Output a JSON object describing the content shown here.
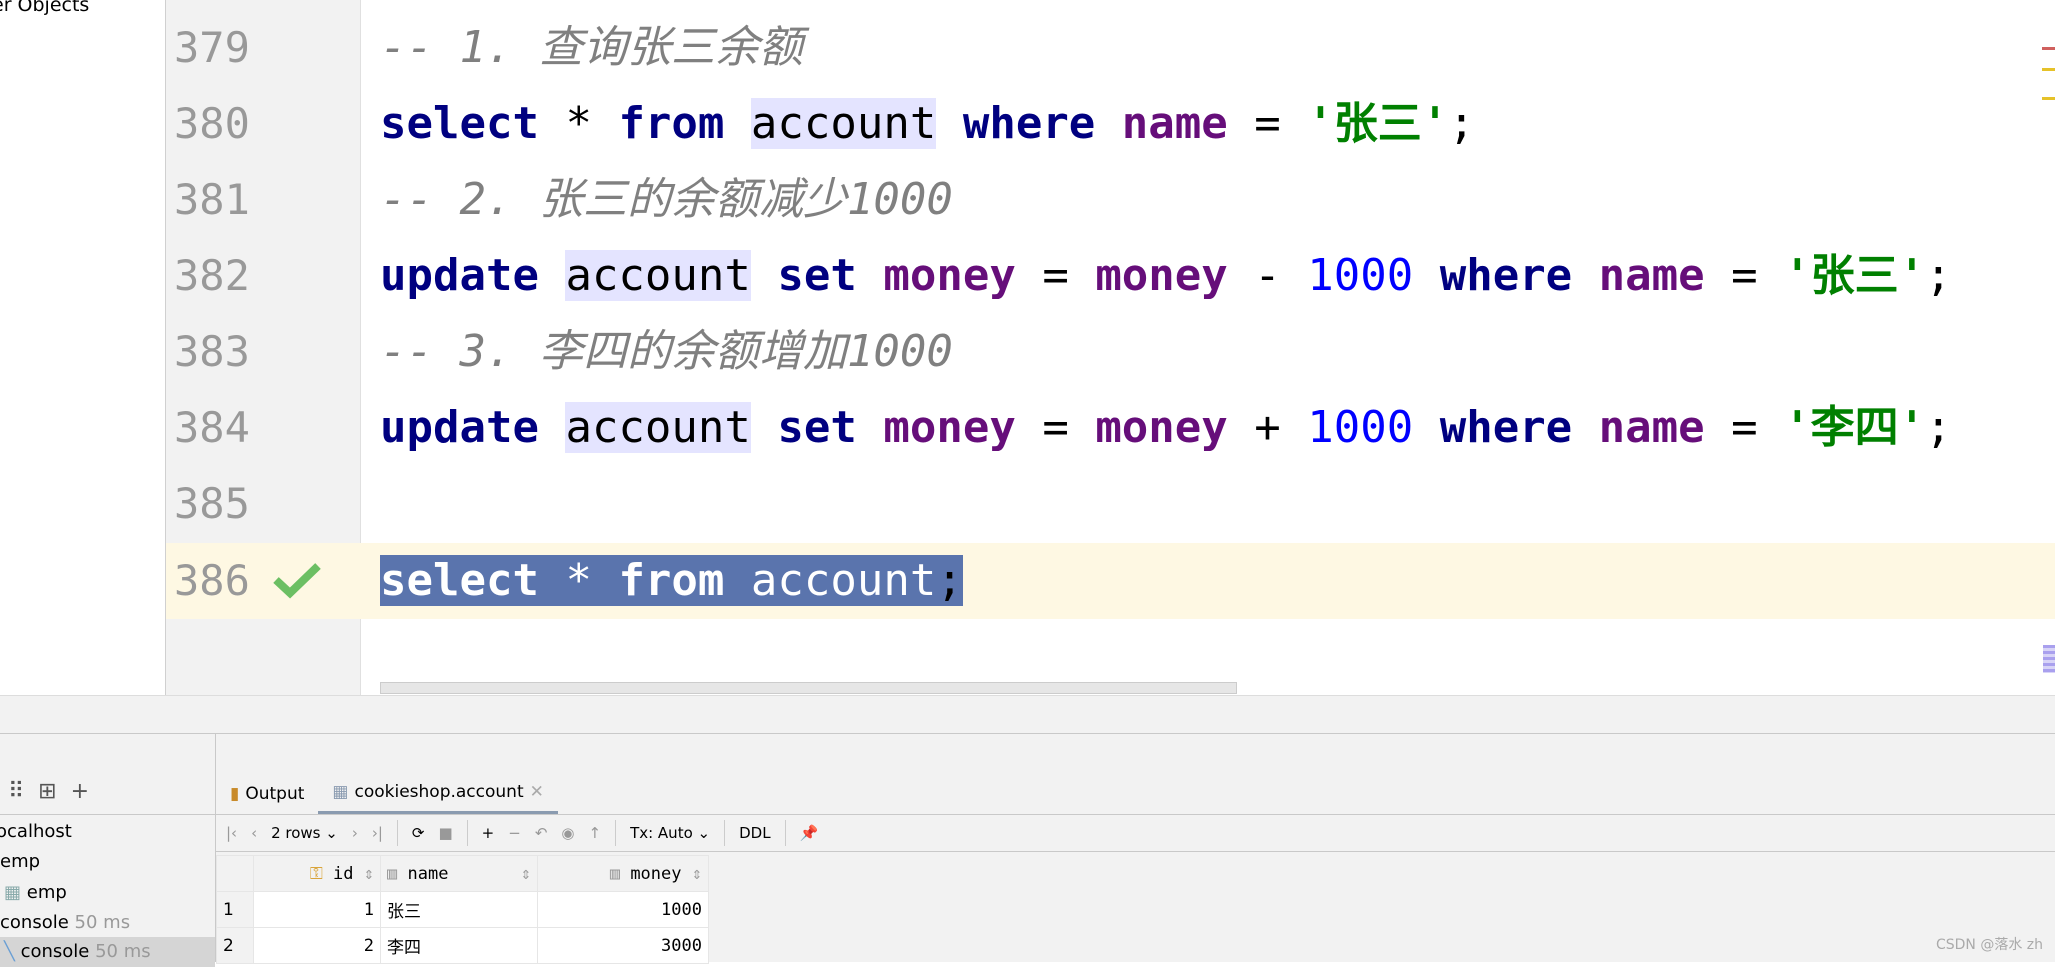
{
  "left_tree": {
    "title": "er Objects"
  },
  "editor": {
    "lines": [
      {
        "number": "379",
        "comment": "-- 1. 查询张三余额"
      },
      {
        "number": "380",
        "kw1": "select",
        "op1": " * ",
        "kw2": "from",
        "table": "account",
        "kw3": "where",
        "col": "name",
        "op2": " = ",
        "str": "'张三'",
        "end": ";"
      },
      {
        "number": "381",
        "comment": "-- 2. 张三的余额减少1000"
      },
      {
        "number": "382",
        "kw1": "update",
        "table": "account",
        "kw2": "set",
        "col1": "money",
        "op1": " = ",
        "col2": "money",
        "op2": " - ",
        "num": "1000",
        "kw3": "where",
        "col3": "name",
        "op3": " = ",
        "str": "'张三'",
        "end": ";"
      },
      {
        "number": "383",
        "comment": "-- 3. 李四的余额增加1000"
      },
      {
        "number": "384",
        "kw1": "update",
        "table": "account",
        "kw2": "set",
        "col1": "money",
        "op1": " = ",
        "col2": "money",
        "op2": " + ",
        "num": "1000",
        "kw3": "where",
        "col3": "name",
        "op3": " = ",
        "str": "'李四'",
        "end": ";"
      },
      {
        "number": "385"
      },
      {
        "number": "386",
        "kw1": "select",
        "op1": " * ",
        "kw2": "from",
        "table": "account",
        "end": ";",
        "status": "check-icon"
      }
    ]
  },
  "bottom": {
    "tree": [
      {
        "label": "ocalhost"
      },
      {
        "label": "emp"
      },
      {
        "label": "emp"
      },
      {
        "label": "console",
        "time": "50 ms"
      },
      {
        "label": "console",
        "time": "50 ms"
      }
    ],
    "tabs": [
      {
        "label": "Output"
      },
      {
        "label": "cookieshop.account",
        "close": "✕"
      }
    ],
    "toolbar": {
      "rows": "2 rows",
      "tx": "Tx: Auto",
      "ddl": "DDL"
    },
    "grid": {
      "columns": [
        "id",
        "name",
        "money"
      ],
      "rows": [
        [
          "1",
          "1",
          "张三",
          "1000"
        ],
        [
          "2",
          "2",
          "李四",
          "3000"
        ]
      ]
    }
  },
  "watermark": "CSDN @落水 zh",
  "colors": {
    "selection": "#5a74ad",
    "current_line": "#fef8e3",
    "keyword": "#000080",
    "string": "#008000"
  }
}
